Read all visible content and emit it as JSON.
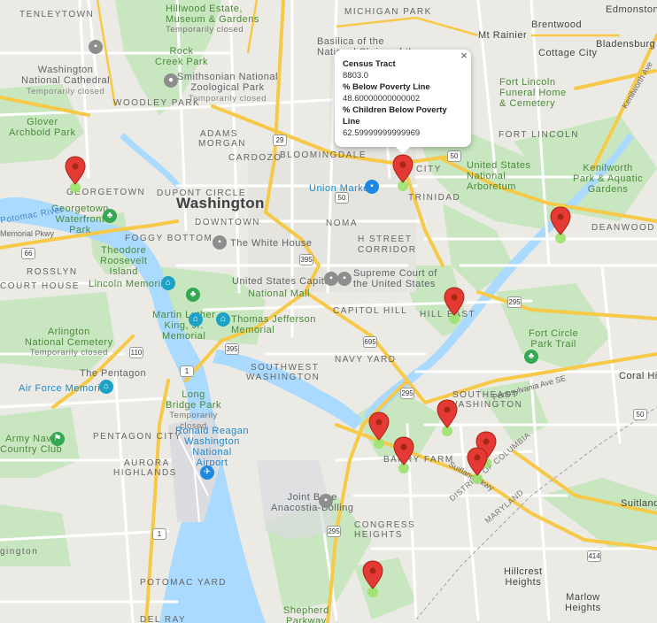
{
  "popup": {
    "title": "Census Tract",
    "tract": "8803.0",
    "poverty_label": "% Below Poverty Line",
    "poverty_value": "48.60000000000002",
    "children_label": "% Children Below Poverty Line",
    "children_value": "62.59999999999969",
    "close": "×"
  },
  "pins_count_marker": "red",
  "colors": {
    "pin": "#e53935",
    "pin_dark": "#a52714",
    "water": "#aadaff",
    "park": "#c5e8c5",
    "highway": "#fdd86a",
    "road": "#ffffff"
  },
  "labels": {
    "city": "Washington",
    "neighborhoods": {
      "tenleytown": "TENLEYTOWN",
      "michigan_park": "MICHIGAN PARK",
      "woodley_park": "WOODLEY PARK",
      "adams_morgan_1": "ADAMS",
      "adams_morgan_2": "MORGAN",
      "cardozo": "CARDOZO",
      "bloomingdale": "BLOOMINGDALE",
      "georgetown": "GEORGETOWN",
      "dupont": "DUPONT CIRCLE",
      "downtown": "DOWNTOWN",
      "foggy": "FOGGY BOTTOM",
      "noma": "NOMA",
      "h_street_1": "H STREET",
      "h_street_2": "CORRIDOR",
      "trinidad": "TRINIDAD",
      "fort_lincoln": "FORT LINCOLN",
      "deanwood": "DEANWOOD",
      "rosslyn": "ROSSLYN",
      "court_house": "COURT HOUSE",
      "capitol_hill": "CAPITOL HILL",
      "hill_east": "HILL EAST",
      "southwest_1": "SOUTHWEST",
      "southwest_2": "WASHINGTON",
      "navy_yard": "NAVY YARD",
      "pentagon_city": "PENTAGON CITY",
      "aurora_1": "AURORA",
      "aurora_2": "HIGHLANDS",
      "southeast_1": "SOUTHEAST",
      "southeast_2": "WASHINGTON",
      "barry_farm": "BARRY FARM",
      "congress_1": "CONGRESS",
      "congress_2": "HEIGHTS",
      "potomac_yard": "POTOMAC YARD",
      "del_ray": "DEL RAY",
      "city_partial": "CITY"
    },
    "places": {
      "hillwood": "Hillwood Estate,",
      "hillwood2": "Museum & Gardens",
      "hillwood_tc": "Temporarily closed",
      "rock_creek": "Rock",
      "rock_creek2": "Creek Park",
      "basilica": "Basilica of the",
      "basilica2": "National Shrine of the...",
      "mt_rainier": "Mt Rainier",
      "brentwood": "Brentwood",
      "edmonston": "Edmonston",
      "bladensburg": "Bladensburg",
      "cottage_city": "Cottage City",
      "cathedral": "Washington",
      "cathedral2": "National Cathedral",
      "cathedral_tc": "Temporarily closed",
      "zoo": "Smithsonian National",
      "zoo2": "Zoological Park",
      "zoo_tc": "Temporarily closed",
      "glover": "Glover",
      "glover2": "Archbold Park",
      "fort_lincoln_fh": "Fort Lincoln",
      "fort_lincoln_fh2": "Funeral Home",
      "fort_lincoln_fh3": "& Cemetery",
      "arboretum": "United States",
      "arboretum2": "National",
      "arboretum3": "Arboretum",
      "kenilworth": "Kenilworth",
      "kenilworth2": "Park & Aquatic",
      "kenilworth3": "Gardens",
      "union_market": "Union Market",
      "georgetown_wf": "Georgetown",
      "georgetown_wf2": "Waterfront",
      "georgetown_wf3": "Park",
      "white_house": "The White House",
      "tri": "Theodore",
      "tri2": "Roosevelt",
      "tri3": "Island",
      "lincoln": "Lincoln Memorial",
      "supreme": "Supreme Court of",
      "supreme2": "the United States",
      "capitol": "United States Capitol",
      "mall": "National Mall",
      "mlk": "Martin Luther",
      "mlk2": "King, Jr.",
      "mlk3": "Memorial",
      "jefferson": "Thomas Jefferson",
      "jefferson2": "Memorial",
      "arlington": "Arlington",
      "arlington2": "National Cemetery",
      "arlington_tc": "Temporarily closed",
      "pentagon": "The Pentagon",
      "af_memorial": "Air Force Memorial",
      "long_bridge": "Long",
      "long_bridge2": "Bridge Park",
      "long_bridge_tc": "Temporarily",
      "long_bridge_tc2": "closed",
      "army_navy": "Army Navy",
      "army_navy2": "Country Club",
      "airport": "Ronald Reagan",
      "airport2": "Washington",
      "airport3": "National",
      "airport4": "Airport",
      "fort_circle": "Fort Circle",
      "fort_circle2": "Park Trail",
      "coral_hills": "Coral Hills",
      "jbab": "Joint Base",
      "jbab2": "Anacostia-Bolling",
      "suitland": "Suitland-",
      "hillcrest": "Hillcrest",
      "hillcrest2": "Heights",
      "marlow": "Marlow",
      "marlow2": "Heights",
      "shepherd": "Shepherd",
      "shepherd2": "Parkway",
      "district_of_columbia": "DISTRICT OF COLUMBIA",
      "maryland": "MARYLAND",
      "potomac_river": "Potomac River",
      "memorial_pkwy": "Memorial Pkwy",
      "gington": "gington",
      "penn_ave": "Pennsylvania Ave SE",
      "kenilworth_ave": "Kenilworth Ave",
      "suitland_pkwy": "Suitland Pkwy"
    },
    "shields": [
      "29",
      "50",
      "50",
      "395",
      "295",
      "295",
      "695",
      "110",
      "1",
      "1",
      "295",
      "66",
      "50",
      "414",
      "395"
    ]
  }
}
